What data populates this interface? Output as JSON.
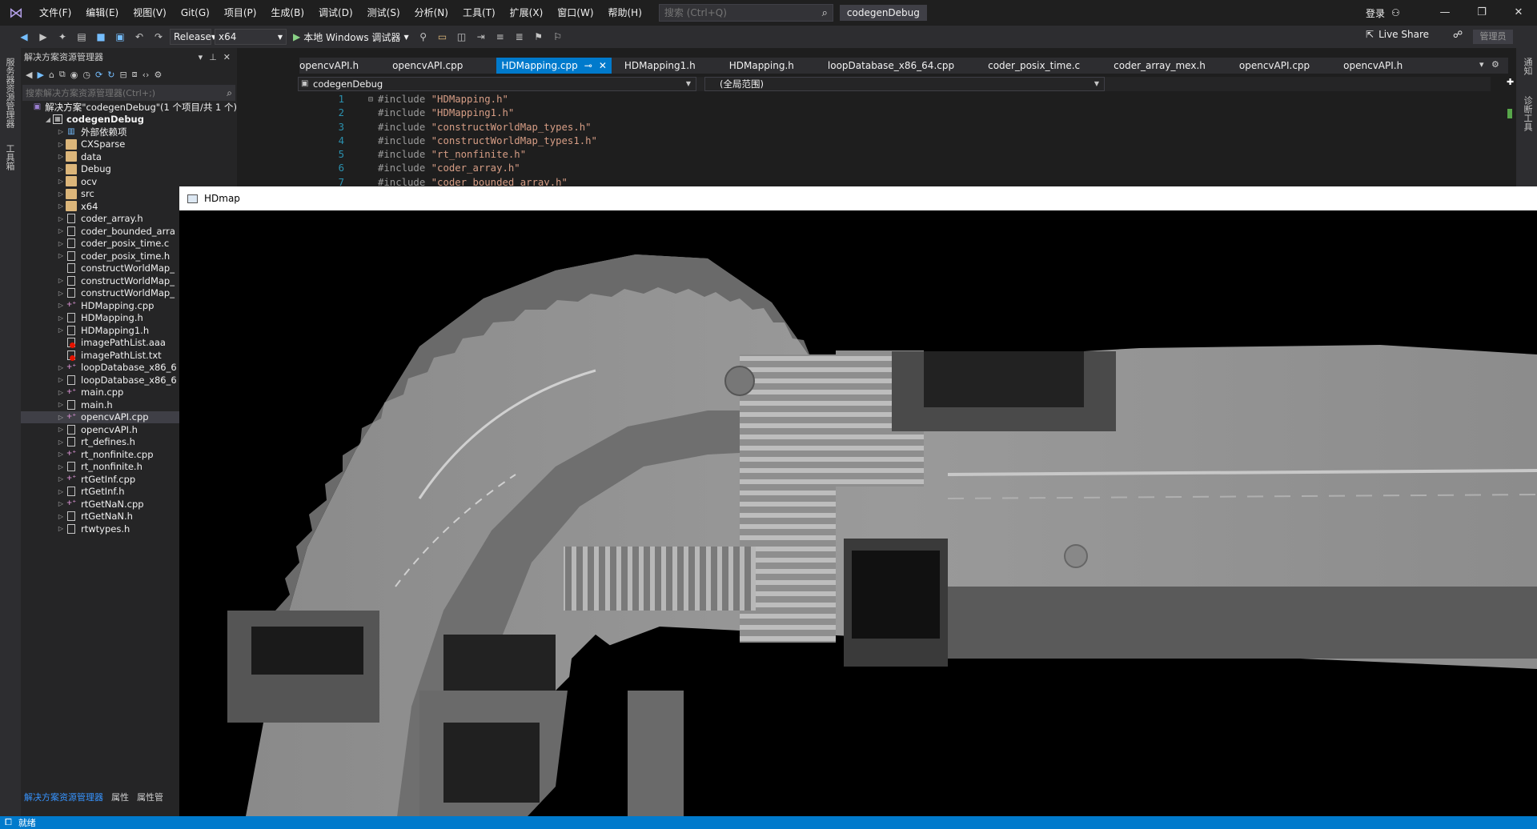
{
  "menu": {
    "items": [
      "文件(F)",
      "编辑(E)",
      "视图(V)",
      "Git(G)",
      "项目(P)",
      "生成(B)",
      "调试(D)",
      "测试(S)",
      "分析(N)",
      "工具(T)",
      "扩展(X)",
      "窗口(W)",
      "帮助(H)"
    ],
    "search_placeholder": "搜索 (Ctrl+Q)",
    "solution_title": "codegenDebug",
    "login": "登录"
  },
  "toolbar": {
    "configuration": "Release",
    "platform": "x64",
    "run_label": "本地 Windows 调试器",
    "live_share": "Live Share",
    "admin": "管理员"
  },
  "left_strip": {
    "tab1": "服务器资源管理器",
    "tab2": "工具箱"
  },
  "right_strip": {
    "tab1": "通知",
    "tab2": "诊断工具"
  },
  "solution_explorer": {
    "title": "解决方案资源管理器",
    "search_placeholder": "搜索解决方案资源管理器(Ctrl+;)",
    "tree": [
      {
        "label": "解决方案\"codegenDebug\"(1 个项目/共 1 个)",
        "icon": "solution",
        "indent": 0,
        "arrow": "",
        "bold": false
      },
      {
        "label": "codegenDebug",
        "icon": "project",
        "indent": 1,
        "arrow": "open",
        "bold": true
      },
      {
        "label": "外部依赖项",
        "icon": "dependency",
        "indent": 2,
        "arrow": "closed"
      },
      {
        "label": "CXSparse",
        "icon": "folder",
        "indent": 2,
        "arrow": "closed"
      },
      {
        "label": "data",
        "icon": "folder",
        "indent": 2,
        "arrow": "closed"
      },
      {
        "label": "Debug",
        "icon": "folder",
        "indent": 2,
        "arrow": "closed"
      },
      {
        "label": "ocv",
        "icon": "folder",
        "indent": 2,
        "arrow": "closed"
      },
      {
        "label": "src",
        "icon": "folder",
        "indent": 2,
        "arrow": "closed"
      },
      {
        "label": "x64",
        "icon": "folder",
        "indent": 2,
        "arrow": "closed"
      },
      {
        "label": "coder_array.h",
        "icon": "file",
        "indent": 2,
        "arrow": "closed"
      },
      {
        "label": "coder_bounded_arra",
        "icon": "file",
        "indent": 2,
        "arrow": "closed"
      },
      {
        "label": "coder_posix_time.c",
        "icon": "file",
        "indent": 2,
        "arrow": "closed"
      },
      {
        "label": "coder_posix_time.h",
        "icon": "file",
        "indent": 2,
        "arrow": "closed"
      },
      {
        "label": "constructWorldMap_",
        "icon": "file",
        "indent": 2,
        "arrow": ""
      },
      {
        "label": "constructWorldMap_",
        "icon": "file",
        "indent": 2,
        "arrow": "closed"
      },
      {
        "label": "constructWorldMap_",
        "icon": "file",
        "indent": 2,
        "arrow": "closed"
      },
      {
        "label": "HDMapping.cpp",
        "icon": "cpp",
        "indent": 2,
        "arrow": "closed"
      },
      {
        "label": "HDMapping.h",
        "icon": "file",
        "indent": 2,
        "arrow": "closed"
      },
      {
        "label": "HDMapping1.h",
        "icon": "file",
        "indent": 2,
        "arrow": "closed"
      },
      {
        "label": "imagePathList.aaa",
        "icon": "txt",
        "indent": 2,
        "arrow": ""
      },
      {
        "label": "imagePathList.txt",
        "icon": "txt",
        "indent": 2,
        "arrow": ""
      },
      {
        "label": "loopDatabase_x86_6",
        "icon": "cpp",
        "indent": 2,
        "arrow": "closed"
      },
      {
        "label": "loopDatabase_x86_6",
        "icon": "file",
        "indent": 2,
        "arrow": "closed"
      },
      {
        "label": "main.cpp",
        "icon": "cpp",
        "indent": 2,
        "arrow": "closed"
      },
      {
        "label": "main.h",
        "icon": "file",
        "indent": 2,
        "arrow": "closed"
      },
      {
        "label": "opencvAPI.cpp",
        "icon": "cpp",
        "indent": 2,
        "arrow": "closed",
        "selected": true
      },
      {
        "label": "opencvAPI.h",
        "icon": "file",
        "indent": 2,
        "arrow": "closed"
      },
      {
        "label": "rt_defines.h",
        "icon": "file",
        "indent": 2,
        "arrow": "closed"
      },
      {
        "label": "rt_nonfinite.cpp",
        "icon": "cpp",
        "indent": 2,
        "arrow": "closed"
      },
      {
        "label": "rt_nonfinite.h",
        "icon": "file",
        "indent": 2,
        "arrow": "closed"
      },
      {
        "label": "rtGetInf.cpp",
        "icon": "cpp",
        "indent": 2,
        "arrow": "closed"
      },
      {
        "label": "rtGetInf.h",
        "icon": "file",
        "indent": 2,
        "arrow": "closed"
      },
      {
        "label": "rtGetNaN.cpp",
        "icon": "cpp",
        "indent": 2,
        "arrow": "closed"
      },
      {
        "label": "rtGetNaN.h",
        "icon": "file",
        "indent": 2,
        "arrow": "closed"
      },
      {
        "label": "rtwtypes.h",
        "icon": "file",
        "indent": 2,
        "arrow": "closed"
      }
    ],
    "bottom_tabs": [
      "解决方案资源管理器",
      "属性",
      "属性管"
    ]
  },
  "editor": {
    "tabs": [
      "opencvAPI.h",
      "opencvAPI.cpp",
      "HDMapping.cpp",
      "HDMapping1.h",
      "HDMapping.h",
      "loopDatabase_x86_64.cpp",
      "coder_posix_time.c",
      "coder_array_mex.h",
      "opencvAPI.cpp",
      "opencvAPI.h"
    ],
    "active_tab_index": 2,
    "nav_project": "codegenDebug",
    "nav_scope": "(全局范围)",
    "lines": [
      {
        "n": "1",
        "kw": "#include",
        "str": "\"HDMapping.h\""
      },
      {
        "n": "2",
        "kw": "#include",
        "str": "\"HDMapping1.h\""
      },
      {
        "n": "3",
        "kw": "#include",
        "str": "\"constructWorldMap_types.h\""
      },
      {
        "n": "4",
        "kw": "#include",
        "str": "\"constructWorldMap_types1.h\""
      },
      {
        "n": "5",
        "kw": "#include",
        "str": "\"rt_nonfinite.h\""
      },
      {
        "n": "6",
        "kw": "#include",
        "str": "\"coder_array.h\""
      },
      {
        "n": "7",
        "kw": "#include",
        "str": "\"coder_bounded_array.h\""
      }
    ]
  },
  "hdmap_window": {
    "title": "HDmap"
  },
  "status": {
    "text": "就绪"
  }
}
